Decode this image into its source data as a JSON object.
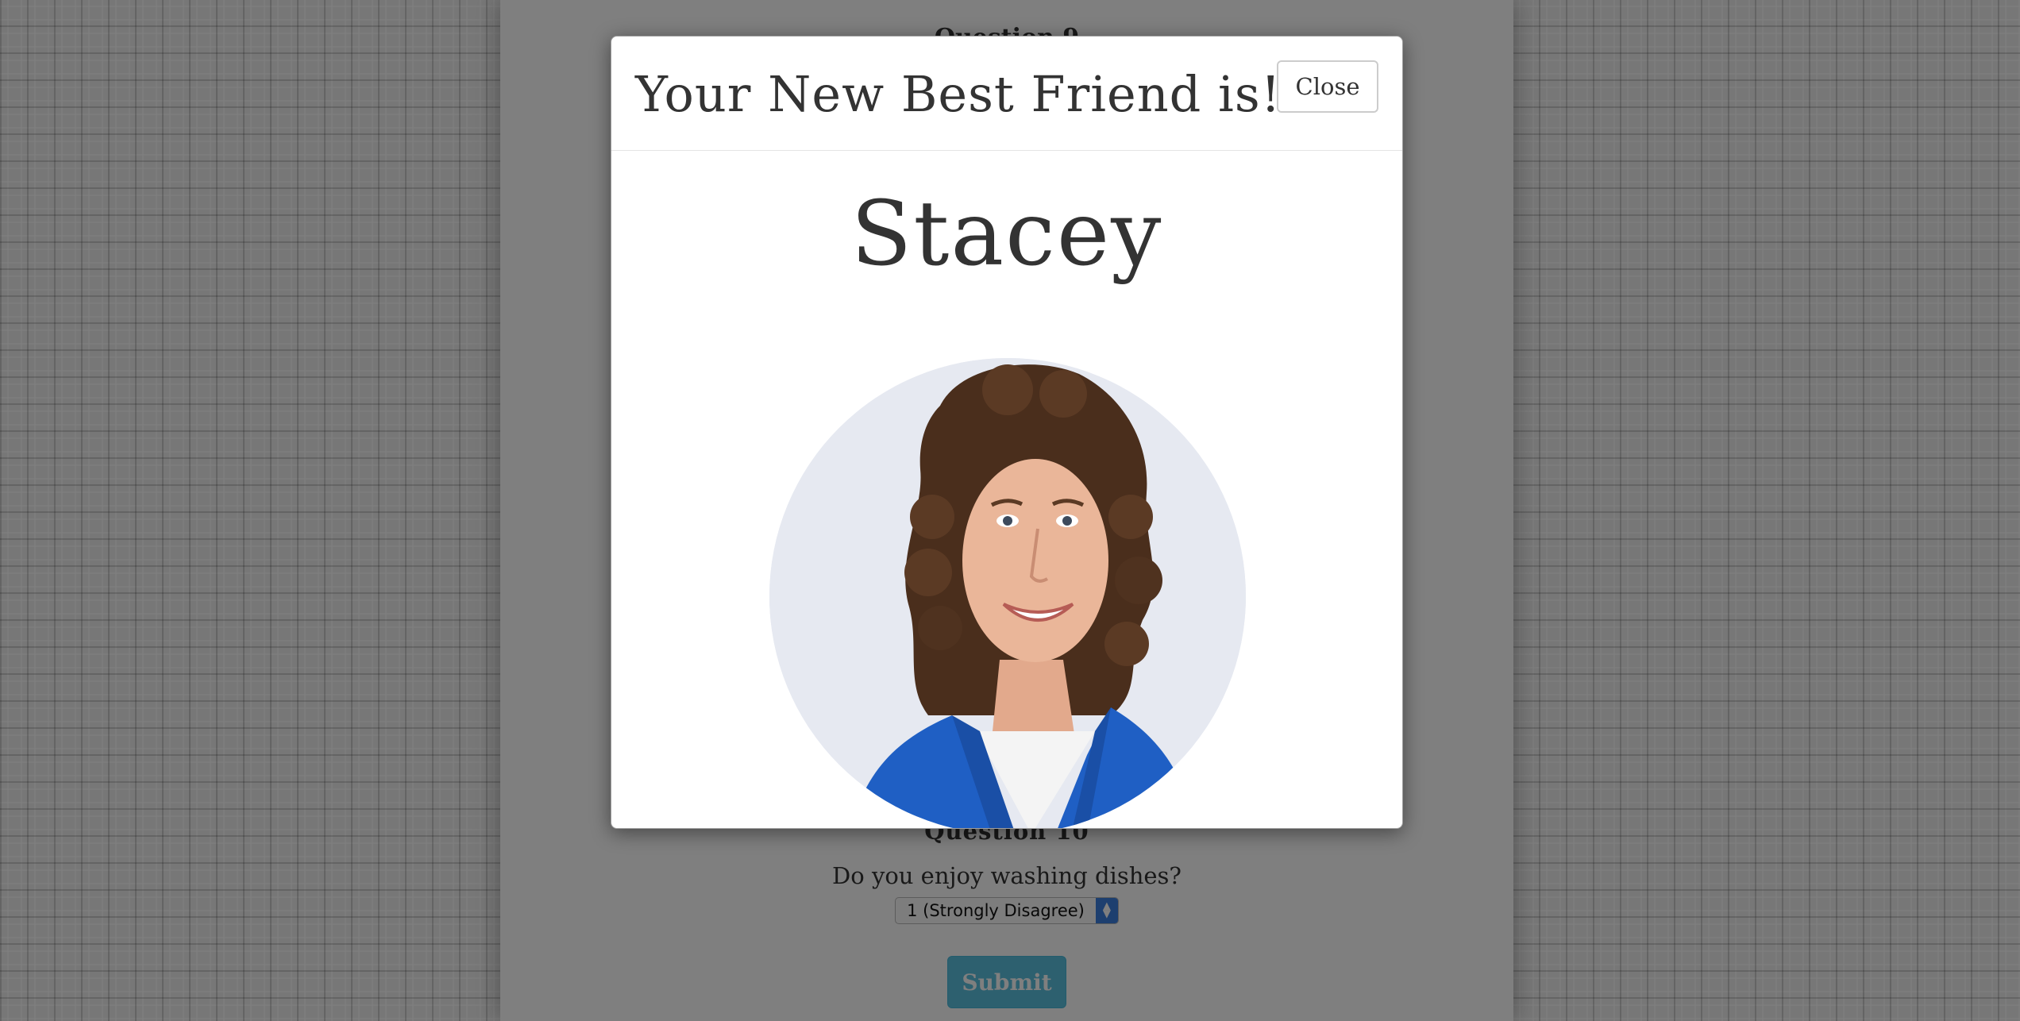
{
  "page": {
    "question_top": "Question 9",
    "question_title": "Question 10",
    "question_text": "Do you enjoy washing dishes?",
    "select_value": "1 (Strongly Disagree)",
    "submit_label": "Submit"
  },
  "modal": {
    "title": "Your New Best Friend is!!!",
    "close_label": "Close",
    "friend_name": "Stacey",
    "photo_icon": "portrait-photo"
  },
  "colors": {
    "submit": "#5bc0de",
    "select_arrow": "#3b7fde",
    "blazer": "#1f5fc4",
    "photo_background": "#e6e9f1"
  }
}
